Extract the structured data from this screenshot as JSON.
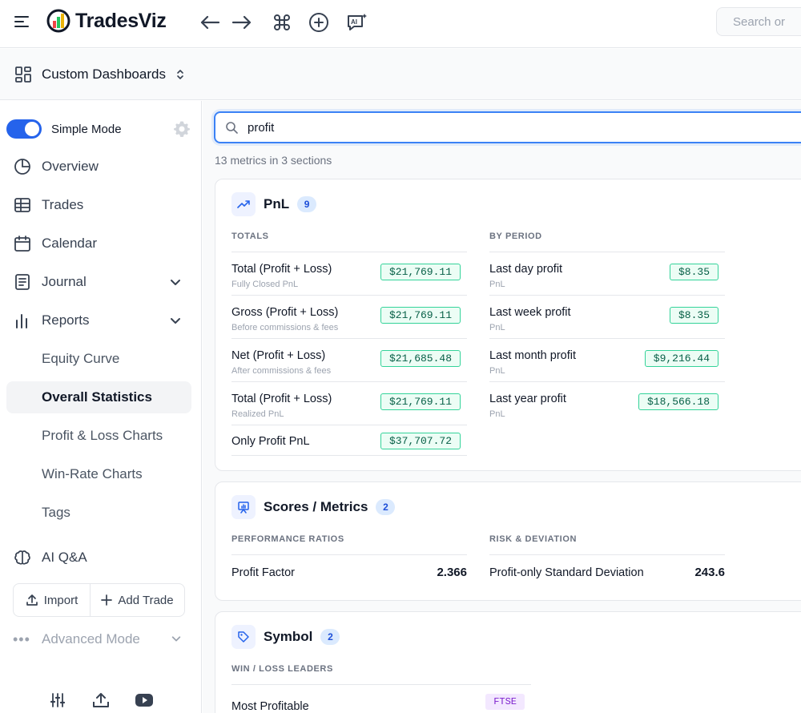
{
  "app": {
    "name": "TradesViz"
  },
  "topbar": {
    "search_placeholder": "Search or",
    "icons": [
      "menu-icon",
      "back-arrow-icon",
      "forward-arrow-icon",
      "command-icon",
      "add-circle-icon",
      "ai-chat-icon",
      "search-icon"
    ]
  },
  "dashboard": {
    "label": "Custom Dashboards"
  },
  "sidebar": {
    "mode_label": "Simple Mode",
    "items": [
      {
        "label": "Overview",
        "icon": "pie-chart-icon"
      },
      {
        "label": "Trades",
        "icon": "table-icon"
      },
      {
        "label": "Calendar",
        "icon": "calendar-icon"
      },
      {
        "label": "Journal",
        "icon": "journal-icon"
      },
      {
        "label": "Reports",
        "icon": "bar-chart-icon"
      }
    ],
    "sub_items": [
      {
        "label": "Equity Curve"
      },
      {
        "label": "Overall Statistics",
        "active": true
      },
      {
        "label": "Profit & Loss Charts"
      },
      {
        "label": "Win-Rate Charts"
      },
      {
        "label": "Tags"
      }
    ],
    "ai_label": "AI Q&A",
    "import_label": "Import",
    "add_trade_label": "Add Trade",
    "advanced_label": "Advanced Mode",
    "bottom_icons": [
      "sliders-icon",
      "upload-icon",
      "youtube-icon"
    ]
  },
  "main": {
    "search_value": "profit",
    "summary": "13 metrics in 3 sections",
    "sections": {
      "pnl": {
        "title": "PnL",
        "count": "9",
        "totals_header": "TOTALS",
        "period_header": "BY PERIOD",
        "totals": [
          {
            "label": "Total (Profit + Loss)",
            "sub": "Fully Closed PnL",
            "value": "$21,769.11"
          },
          {
            "label": "Gross (Profit + Loss)",
            "sub": "Before commissions & fees",
            "value": "$21,769.11"
          },
          {
            "label": "Net (Profit + Loss)",
            "sub": "After commissions & fees",
            "value": "$21,685.48"
          },
          {
            "label": "Total (Profit + Loss)",
            "sub": "Realized PnL",
            "value": "$21,769.11"
          },
          {
            "label": "Only Profit PnL",
            "sub": "",
            "value": "$37,707.72"
          }
        ],
        "period": [
          {
            "label": "Last day profit",
            "sub": "PnL",
            "value": "$8.35"
          },
          {
            "label": "Last week profit",
            "sub": "PnL",
            "value": "$8.35"
          },
          {
            "label": "Last month profit",
            "sub": "PnL",
            "value": "$9,216.44"
          },
          {
            "label": "Last year profit",
            "sub": "PnL",
            "value": "$18,566.18"
          }
        ]
      },
      "scores": {
        "title": "Scores / Metrics",
        "count": "2",
        "perf_header": "PERFORMANCE RATIOS",
        "risk_header": "RISK & DEVIATION",
        "perf": [
          {
            "label": "Profit Factor",
            "value": "2.366"
          }
        ],
        "risk": [
          {
            "label": "Profit-only Standard Deviation",
            "value": "243.6"
          }
        ]
      },
      "symbol": {
        "title": "Symbol",
        "count": "2",
        "leaders_header": "WIN / LOSS LEADERS",
        "leaders": [
          {
            "label": "Most Profitable",
            "value": "FTSE"
          }
        ]
      }
    }
  }
}
